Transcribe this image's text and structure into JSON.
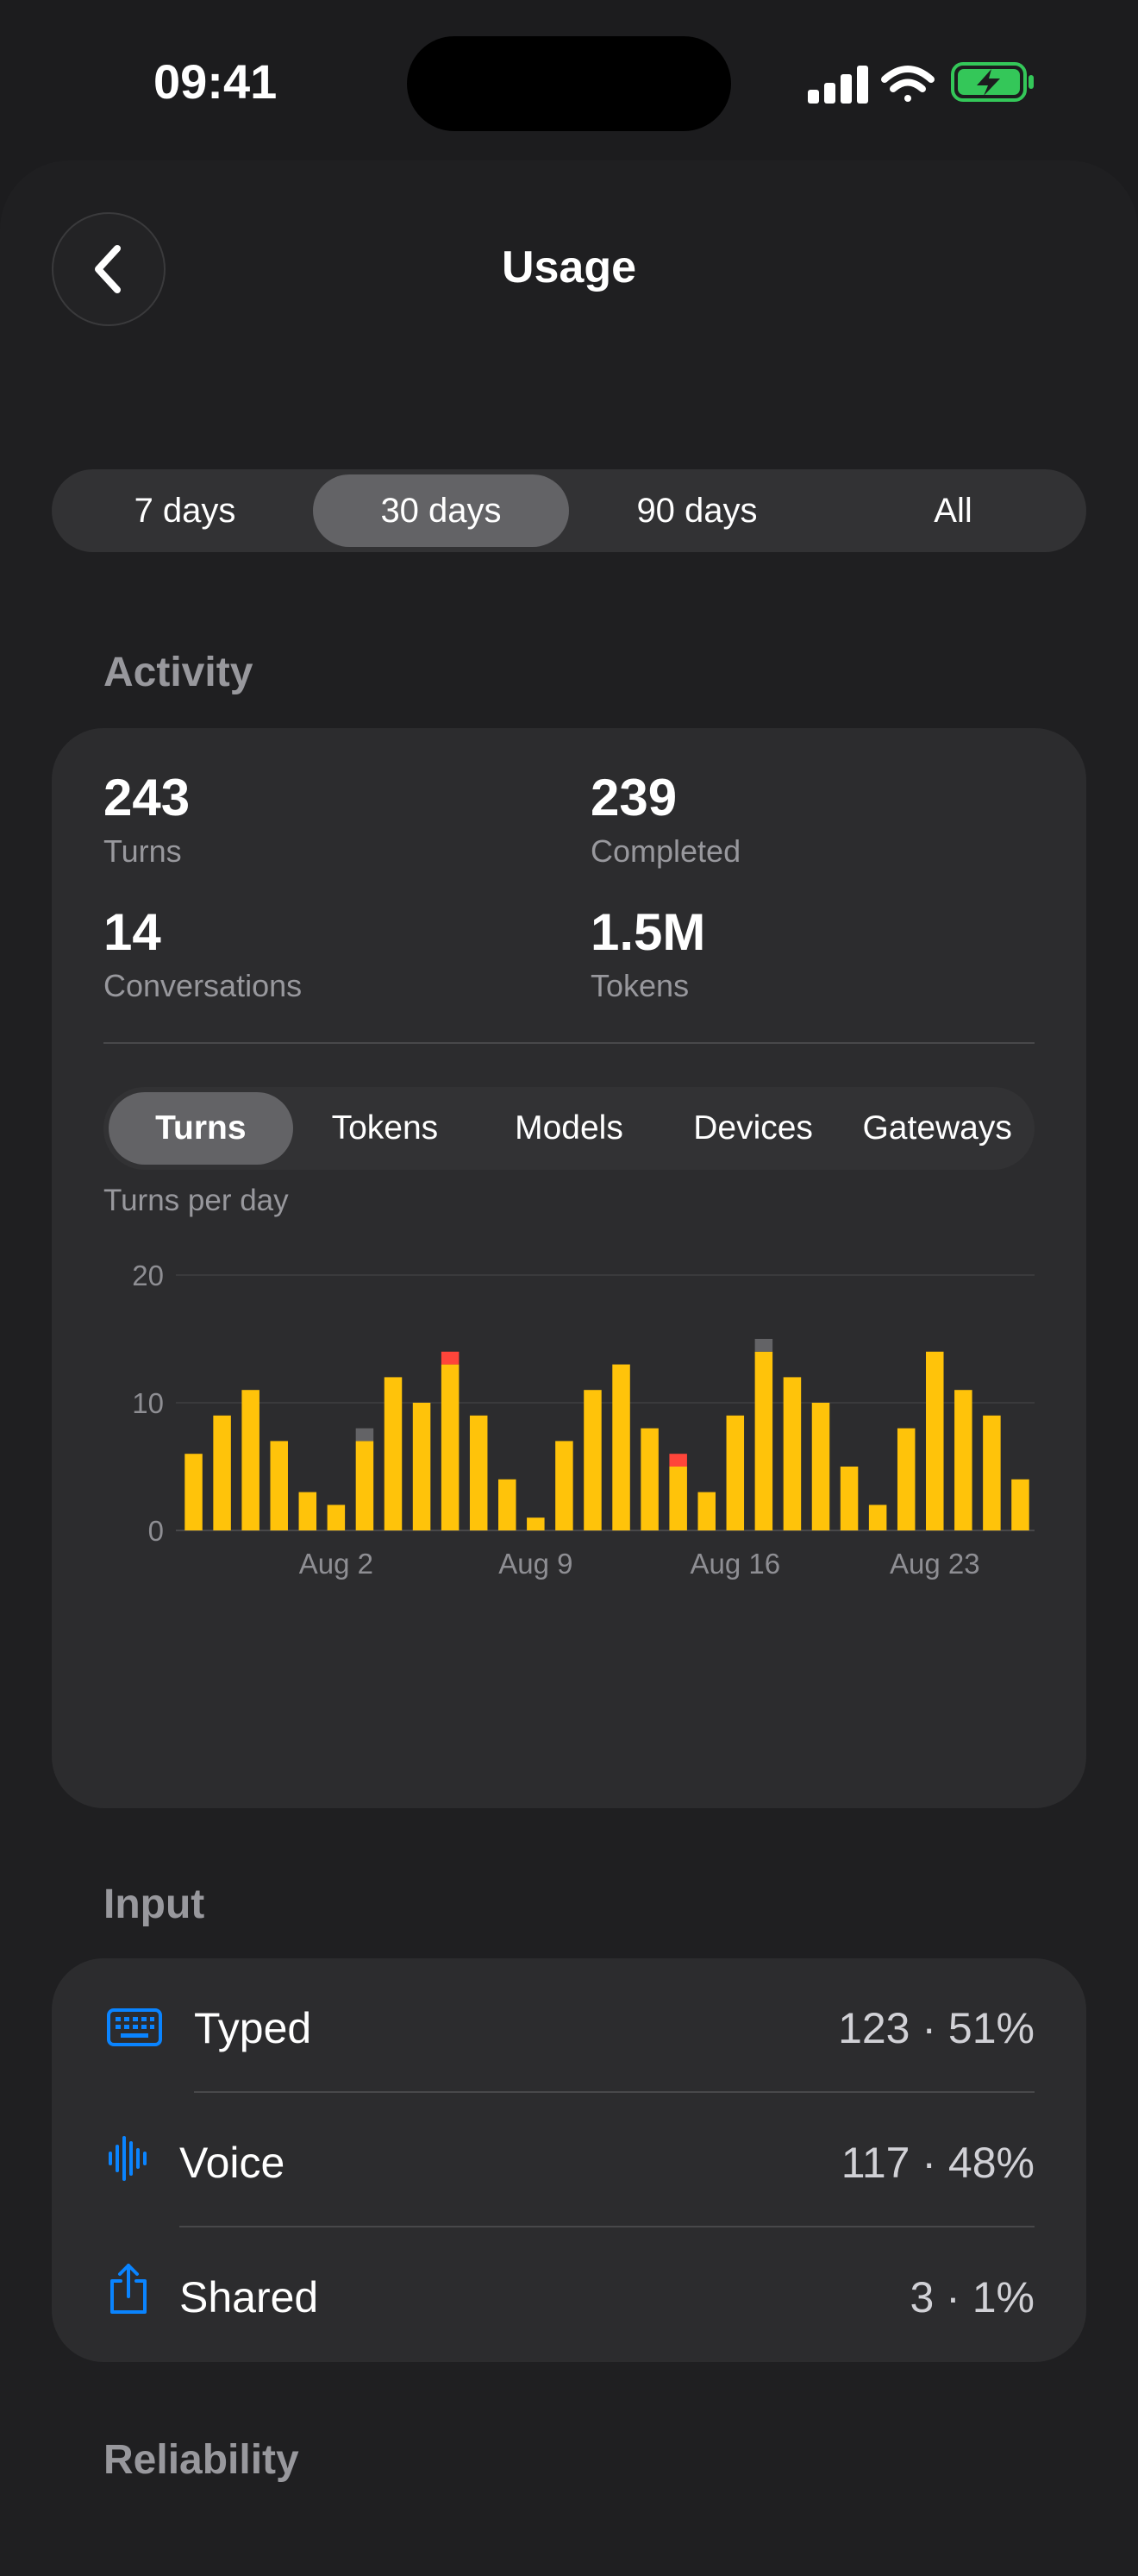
{
  "status_bar": {
    "time": "09:41",
    "battery_color": "#34c759"
  },
  "nav": {
    "title": "Usage",
    "back_icon": "chevron-left-icon"
  },
  "range_tabs": [
    {
      "label": "7 days",
      "selected": false
    },
    {
      "label": "30 days",
      "selected": true
    },
    {
      "label": "90 days",
      "selected": false
    },
    {
      "label": "All",
      "selected": false
    }
  ],
  "activity": {
    "section_title": "Activity",
    "stats": [
      {
        "value": "243",
        "label": "Turns"
      },
      {
        "value": "239",
        "label": "Completed"
      },
      {
        "value": "14",
        "label": "Conversations"
      },
      {
        "value": "1.5M",
        "label": "Tokens"
      }
    ],
    "metric_tabs": [
      {
        "label": "Turns",
        "selected": true
      },
      {
        "label": "Tokens",
        "selected": false
      },
      {
        "label": "Models",
        "selected": false
      },
      {
        "label": "Devices",
        "selected": false
      },
      {
        "label": "Gateways",
        "selected": false
      }
    ],
    "chart_subtitle": "Turns per day"
  },
  "chart_data": {
    "type": "bar",
    "stacked": true,
    "title": "Turns per day",
    "x": [
      "Jul 28",
      "Jul 29",
      "Jul 30",
      "Jul 31",
      "Aug 1",
      "Aug 2",
      "Aug 3",
      "Aug 4",
      "Aug 5",
      "Aug 6",
      "Aug 7",
      "Aug 8",
      "Aug 9",
      "Aug 10",
      "Aug 11",
      "Aug 12",
      "Aug 13",
      "Aug 14",
      "Aug 15",
      "Aug 16",
      "Aug 17",
      "Aug 18",
      "Aug 19",
      "Aug 20",
      "Aug 21",
      "Aug 22",
      "Aug 23",
      "Aug 24",
      "Aug 25",
      "Aug 26"
    ],
    "x_tick_labels": [
      "Aug 2",
      "Aug 9",
      "Aug 16",
      "Aug 23"
    ],
    "series": [
      {
        "color": "#ffc30a",
        "values": [
          6,
          9,
          11,
          7,
          3,
          2,
          7,
          12,
          10,
          13,
          9,
          4,
          1,
          7,
          11,
          13,
          8,
          5,
          3,
          9,
          14,
          12,
          10,
          5,
          2,
          8,
          14,
          11,
          9,
          4
        ]
      },
      {
        "color": "#636366",
        "values": [
          0,
          0,
          0,
          0,
          0,
          0,
          1,
          0,
          0,
          0,
          0,
          0,
          0,
          0,
          0,
          0,
          0,
          0,
          0,
          0,
          1,
          0,
          0,
          0,
          0,
          0,
          0,
          0,
          0,
          0
        ]
      },
      {
        "color": "#ff453a",
        "values": [
          0,
          0,
          0,
          0,
          0,
          0,
          0,
          0,
          0,
          1,
          0,
          0,
          0,
          0,
          0,
          0,
          0,
          1,
          0,
          0,
          0,
          0,
          0,
          0,
          0,
          0,
          0,
          0,
          0,
          0
        ]
      }
    ],
    "yticks": [
      0,
      10,
      20
    ],
    "ylim": [
      0,
      20
    ],
    "grid": true
  },
  "input": {
    "section_title": "Input",
    "rows": [
      {
        "icon": "keyboard-icon",
        "label": "Typed",
        "value": "123 · 51%"
      },
      {
        "icon": "waveform-icon",
        "label": "Voice",
        "value": "117 · 48%"
      },
      {
        "icon": "share-icon",
        "label": "Shared",
        "value": "3 · 1%"
      }
    ],
    "accent": "#0a84ff"
  },
  "reliability": {
    "section_title": "Reliability"
  }
}
